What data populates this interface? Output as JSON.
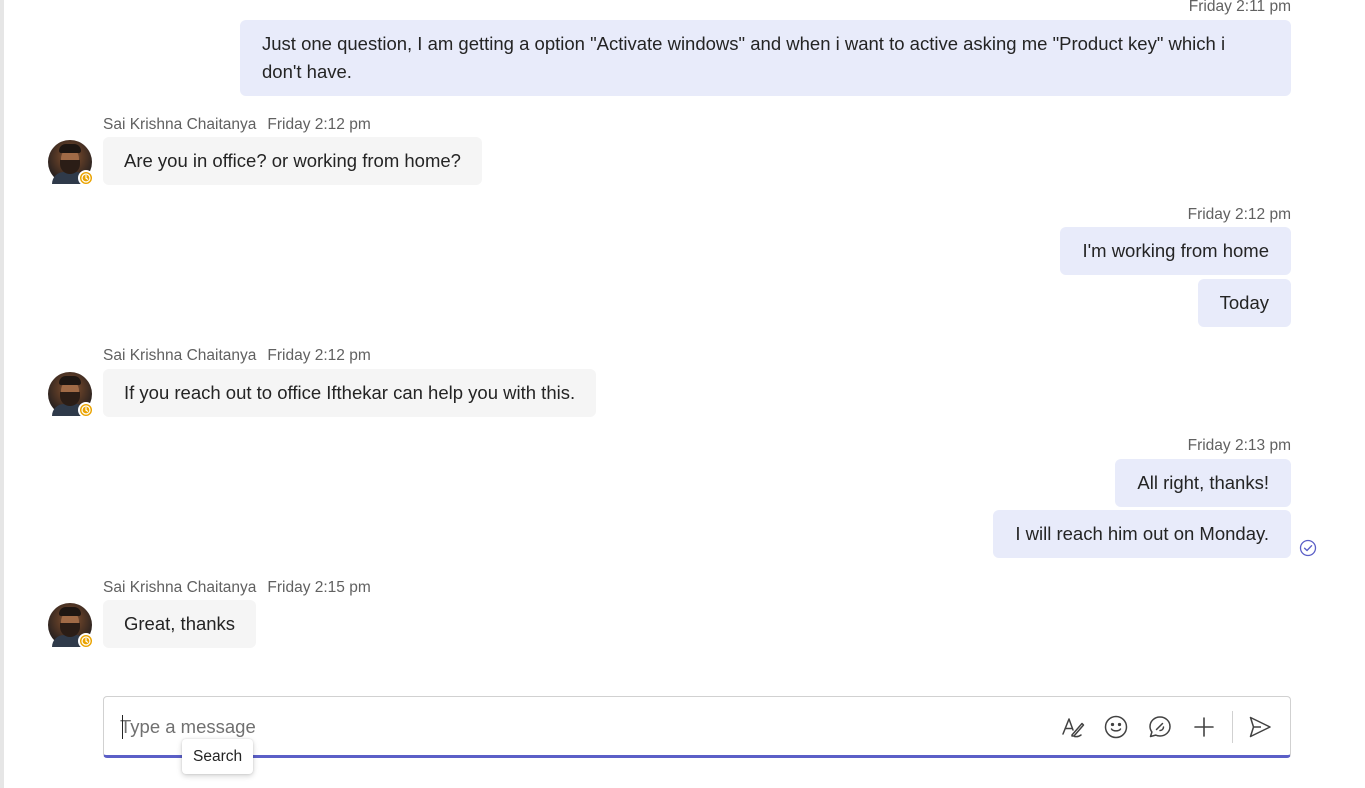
{
  "messages": {
    "m1": {
      "time": "Friday 2:11 pm",
      "text": "Just one question, I am getting a option \"Activate windows\" and when i want to active asking me \"Product key\" which i don't have."
    },
    "m2": {
      "sender": "Sai Krishna Chaitanya",
      "time": "Friday 2:12 pm",
      "text": "Are you in office? or working from home?"
    },
    "m3": {
      "time": "Friday 2:12 pm",
      "text1": "I'm working from home",
      "text2": "Today"
    },
    "m4": {
      "sender": "Sai Krishna Chaitanya",
      "time": "Friday 2:12 pm",
      "text": "If you reach out to office Ifthekar can help you with this."
    },
    "m5": {
      "time": "Friday 2:13 pm",
      "text1": "All right, thanks!",
      "text2": "I will reach him out on Monday."
    },
    "m6": {
      "sender": "Sai Krishna Chaitanya",
      "time": "Friday 2:15 pm",
      "text": "Great, thanks"
    }
  },
  "composer": {
    "placeholder": "Type a message",
    "value": "",
    "tools": [
      "format-icon",
      "emoji-icon",
      "sticker-icon",
      "add-icon",
      "send-icon"
    ]
  },
  "tooltip": {
    "label": "Search"
  },
  "icons": {
    "status": "clock-away-icon",
    "read_receipt": "seen-check-icon"
  },
  "colors": {
    "my_bubble": "#e8ebfa",
    "their_bubble": "#f5f5f5",
    "accent": "#5b5fc7",
    "away_status": "#eaa300"
  }
}
